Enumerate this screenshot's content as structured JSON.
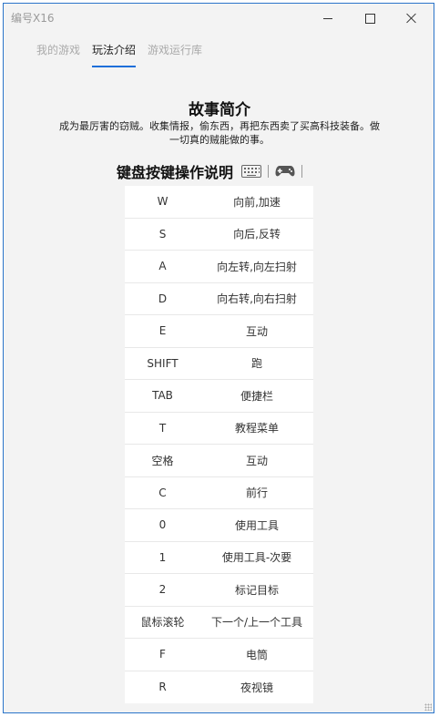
{
  "window": {
    "title": "编号X16"
  },
  "tabs": [
    {
      "label": "我的游戏"
    },
    {
      "label": "玩法介绍"
    },
    {
      "label": "游戏运行库"
    }
  ],
  "story": {
    "title": "故事简介",
    "text": "成为最厉害的窃贼。收集情报，偷东西，再把东西卖了买高科技装备。做一切真的贼能做的事。"
  },
  "keys_section": {
    "title": "键盘按键操作说明"
  },
  "keys": [
    {
      "key": "W",
      "desc": "向前,加速"
    },
    {
      "key": "S",
      "desc": "向后,反转"
    },
    {
      "key": "A",
      "desc": "向左转,向左扫射"
    },
    {
      "key": "D",
      "desc": "向右转,向右扫射"
    },
    {
      "key": "E",
      "desc": "互动"
    },
    {
      "key": "SHIFT",
      "desc": "跑"
    },
    {
      "key": "TAB",
      "desc": "便捷栏"
    },
    {
      "key": "T",
      "desc": "教程菜单"
    },
    {
      "key": "空格",
      "desc": "互动"
    },
    {
      "key": "C",
      "desc": "前行"
    },
    {
      "key": "0",
      "desc": "使用工具"
    },
    {
      "key": "1",
      "desc": "使用工具-次要"
    },
    {
      "key": "2",
      "desc": "标记目标"
    },
    {
      "key": "鼠标滚轮",
      "desc": "下一个/上一个工具"
    },
    {
      "key": "F",
      "desc": "电筒"
    },
    {
      "key": "R",
      "desc": "夜视镜"
    }
  ]
}
